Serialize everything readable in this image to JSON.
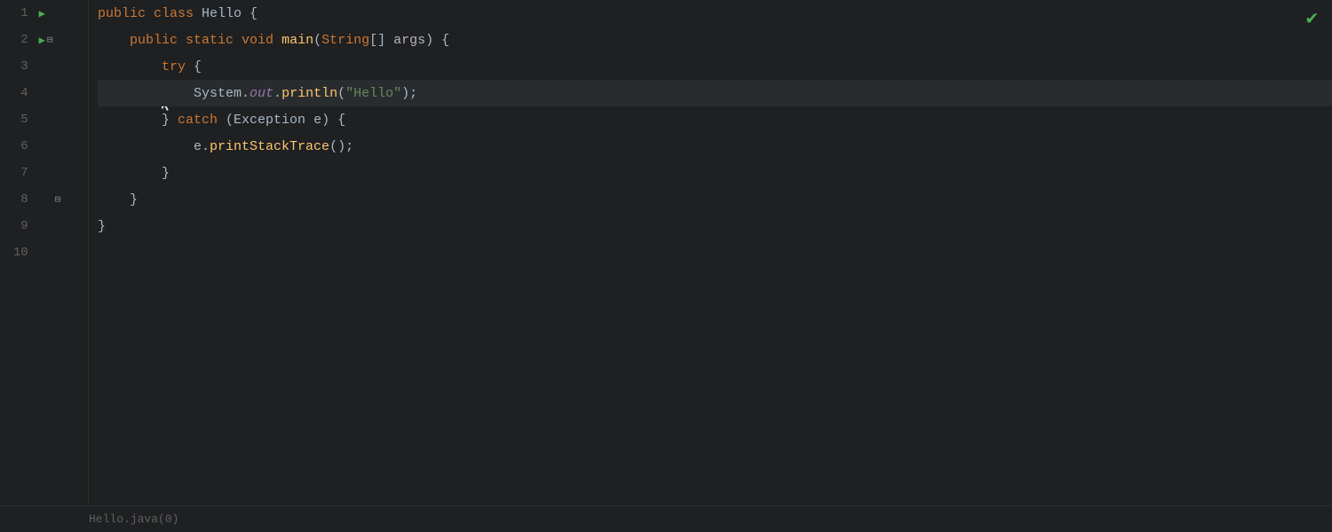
{
  "editor": {
    "background": "#1e2022",
    "checkmark": "✔",
    "lines": [
      {
        "number": "1",
        "has_run_arrow": true,
        "has_fold": false,
        "content": [
          {
            "type": "kw",
            "text": "public "
          },
          {
            "type": "kw",
            "text": "class "
          },
          {
            "type": "class-name",
            "text": "Hello "
          },
          {
            "type": "plain",
            "text": "{"
          }
        ],
        "raw": "public class Hello {"
      },
      {
        "number": "2",
        "has_run_arrow": true,
        "has_fold": true,
        "content": [
          {
            "type": "kw",
            "text": "    public "
          },
          {
            "type": "kw",
            "text": "static "
          },
          {
            "type": "kw",
            "text": "void "
          },
          {
            "type": "method-name",
            "text": "main"
          },
          {
            "type": "plain",
            "text": "("
          },
          {
            "type": "kw",
            "text": "String"
          },
          {
            "type": "plain",
            "text": "[] "
          },
          {
            "type": "param",
            "text": "args"
          },
          {
            "type": "plain",
            "text": ") {"
          }
        ],
        "raw": "    public static void main(String[] args) {"
      },
      {
        "number": "3",
        "has_run_arrow": false,
        "has_fold": false,
        "content": [
          {
            "type": "plain",
            "text": "        "
          },
          {
            "type": "kw",
            "text": "try"
          },
          {
            "type": "plain",
            "text": " {"
          }
        ],
        "raw": "        try {"
      },
      {
        "number": "4",
        "has_run_arrow": false,
        "has_fold": false,
        "is_active": true,
        "content": [
          {
            "type": "plain",
            "text": "            System."
          },
          {
            "type": "out-italic",
            "text": "out"
          },
          {
            "type": "plain",
            "text": "."
          },
          {
            "type": "println",
            "text": "println"
          },
          {
            "type": "plain",
            "text": "("
          },
          {
            "type": "string",
            "text": "\"Hello\""
          },
          {
            "type": "plain",
            "text": ");"
          }
        ],
        "raw": "            System.out.println(\"Hello\");"
      },
      {
        "number": "5",
        "has_run_arrow": false,
        "has_fold": false,
        "content": [
          {
            "type": "plain",
            "text": "        } "
          },
          {
            "type": "kw",
            "text": "catch"
          },
          {
            "type": "plain",
            "text": " ("
          },
          {
            "type": "class-name",
            "text": "Exception "
          },
          {
            "type": "param",
            "text": "e"
          },
          {
            "type": "plain",
            "text": ") {"
          }
        ],
        "raw": "        } catch (Exception e) {"
      },
      {
        "number": "6",
        "has_run_arrow": false,
        "has_fold": false,
        "content": [
          {
            "type": "plain",
            "text": "            e."
          },
          {
            "type": "println",
            "text": "printStackTrace"
          },
          {
            "type": "plain",
            "text": "();"
          }
        ],
        "raw": "            e.printStackTrace();"
      },
      {
        "number": "7",
        "has_run_arrow": false,
        "has_fold": false,
        "content": [
          {
            "type": "plain",
            "text": "        }"
          }
        ],
        "raw": "        }"
      },
      {
        "number": "8",
        "has_run_arrow": false,
        "has_fold": true,
        "is_fold_close": true,
        "content": [
          {
            "type": "plain",
            "text": "    }"
          }
        ],
        "raw": "    }"
      },
      {
        "number": "9",
        "has_run_arrow": false,
        "has_fold": false,
        "content": [
          {
            "type": "plain",
            "text": "}"
          }
        ],
        "raw": "}"
      },
      {
        "number": "10",
        "has_run_arrow": false,
        "has_fold": false,
        "content": [],
        "raw": ""
      }
    ],
    "bottom_hint": "Hello.java(0)"
  }
}
